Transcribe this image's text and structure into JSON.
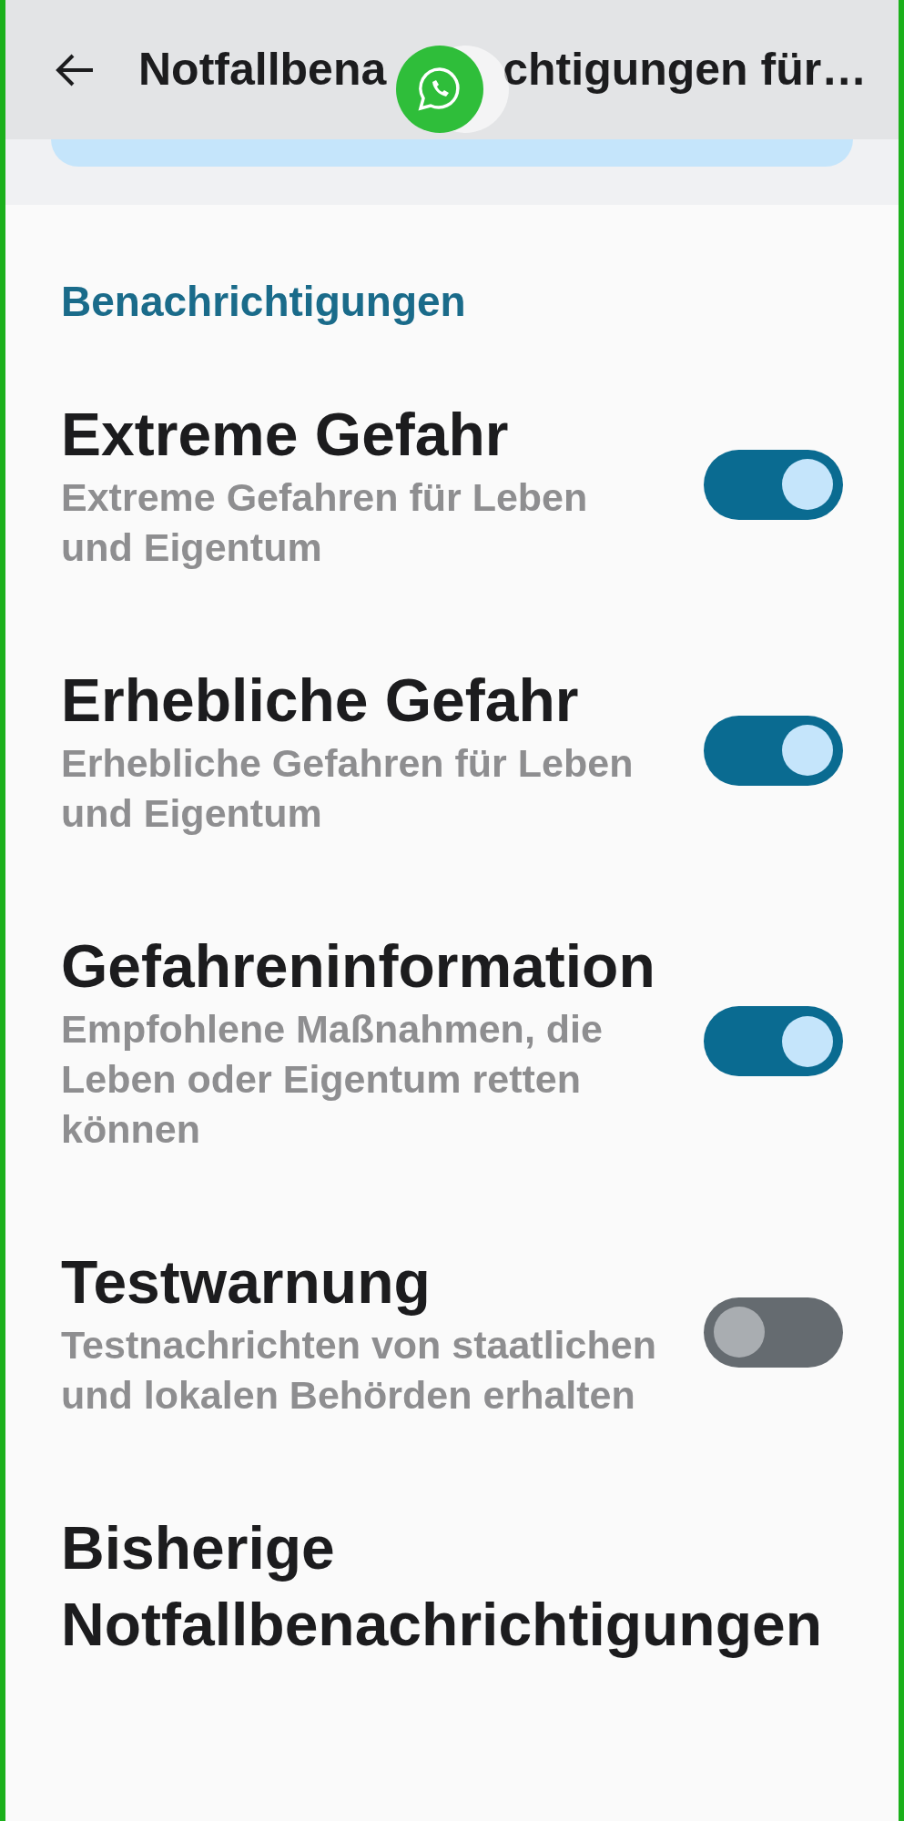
{
  "top_bar": {
    "title_start": "Notfallbena",
    "title_end": "chtigungen für…"
  },
  "section": {
    "heading": "Benachrichtigungen"
  },
  "settings": [
    {
      "kind": "toggle",
      "title": "Extreme Gefahr",
      "subtitle": "Extreme Gefahren für Leben und Eigentum",
      "on": true
    },
    {
      "kind": "toggle",
      "title": "Erhebliche Gefahr",
      "subtitle": "Erhebliche Gefahren für Leben und Eigentum",
      "on": true
    },
    {
      "kind": "toggle",
      "title": "Gefahreninformation",
      "subtitle": "Empfohlene Maßnahmen, die Leben oder Eigentum retten können",
      "on": true
    },
    {
      "kind": "toggle",
      "title": "Testwarnung",
      "subtitle": "Testnachrichten von staatlichen und lokalen Behörden erhalten",
      "on": false
    },
    {
      "kind": "link",
      "title": "Bisherige Notfallbenachrichtigungen"
    }
  ]
}
